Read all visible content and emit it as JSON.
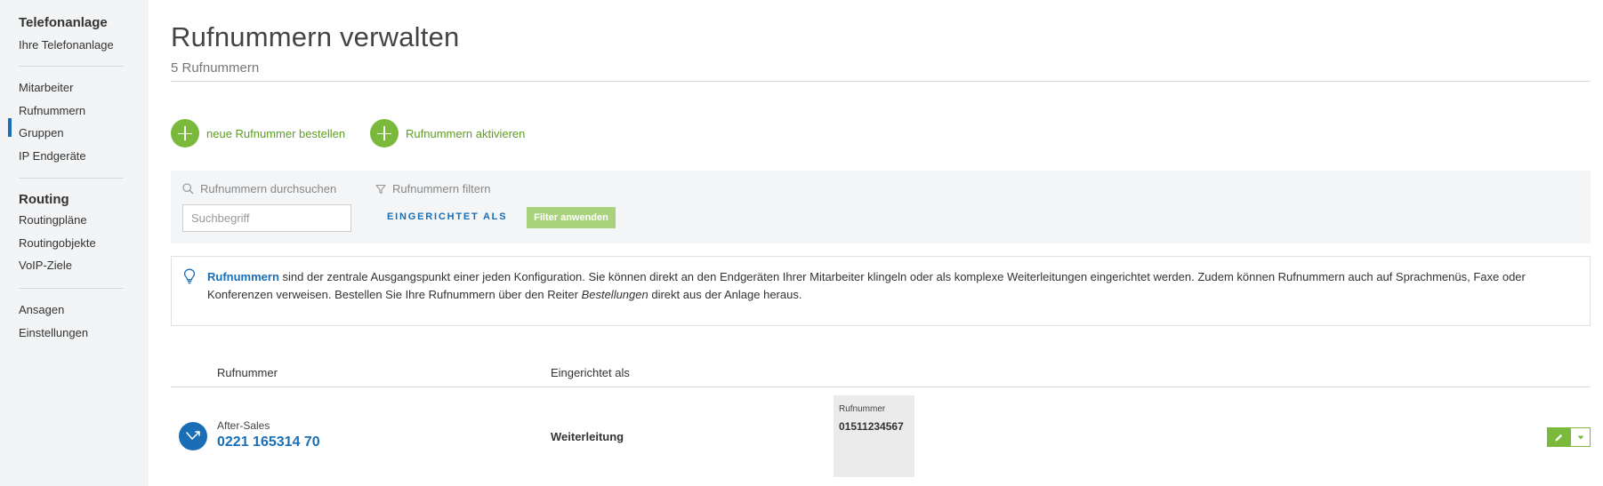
{
  "sidebar": {
    "section1_heading": "Telefonanlage",
    "section1_items": [
      "Ihre Telefonanlage"
    ],
    "section2_items": [
      "Mitarbeiter",
      "Rufnummern",
      "Gruppen",
      "IP Endgeräte"
    ],
    "active_item": "Rufnummern",
    "section3_heading": "Routing",
    "section3_items": [
      "Routingpläne",
      "Routingobjekte",
      "VoIP-Ziele"
    ],
    "section4_items": [
      "Ansagen",
      "Einstellungen"
    ]
  },
  "header": {
    "title": "Rufnummern verwalten",
    "subtitle": "5 Rufnummern"
  },
  "actions": {
    "order_label": "neue Rufnummer bestellen",
    "activate_label": "Rufnummern aktivieren"
  },
  "filter": {
    "search_label": "Rufnummern durchsuchen",
    "search_placeholder": "Suchbegriff",
    "filter_label": "Rufnummern filtern",
    "eingerichtet_label": "EINGERICHTET ALS",
    "apply_label": "Filter anwenden"
  },
  "info": {
    "link_text": "Rufnummern",
    "text_part1": " sind der zentrale Ausgangspunkt einer jeden Konfiguration. Sie können direkt an den Endgeräten Ihrer Mitarbeiter klingeln oder als komplexe Weiterleitungen eingerichtet werden. Zudem können Rufnummern auch auf Sprachmenüs, Faxe oder Konferenzen verweisen. Bestellen Sie Ihre Rufnummern über den Reiter ",
    "text_em": "Bestellungen",
    "text_part2": " direkt aus der Anlage heraus."
  },
  "table": {
    "columns": [
      "Rufnummer",
      "Eingerichtet als"
    ],
    "rows": [
      {
        "name": "After-Sales",
        "number": "0221 165314 70",
        "type": "Weiterleitung",
        "target_label": "Rufnummer",
        "target_value": "01511234567"
      }
    ]
  },
  "colors": {
    "brand_blue": "#1a6eb5",
    "accent_green": "#7ab93b",
    "sidebar_bg": "#f3f4f6"
  }
}
